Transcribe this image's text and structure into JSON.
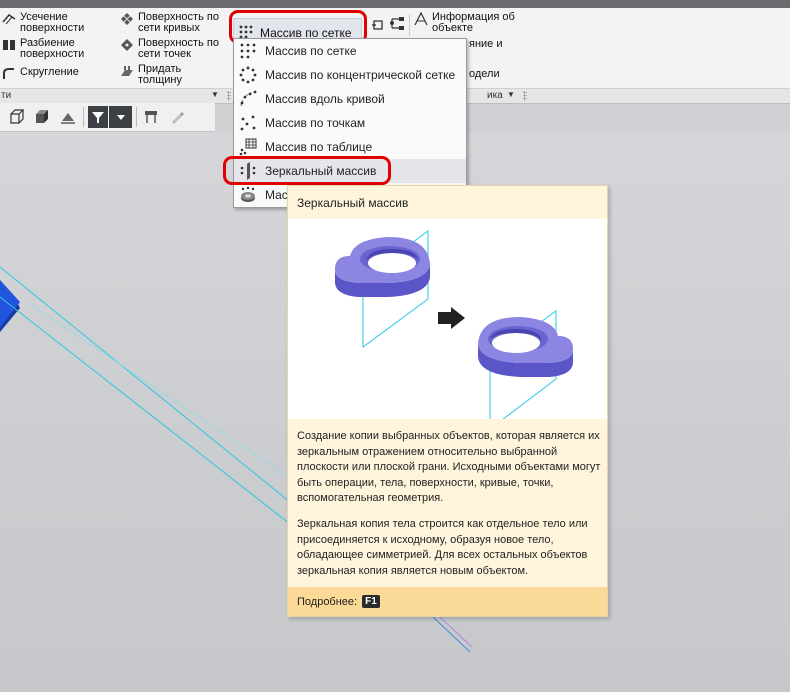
{
  "ribbon": {
    "col1": [
      {
        "icon": "trim-surface-icon",
        "label": "Усечение поверхности"
      },
      {
        "icon": "split-surface-icon",
        "label": "Разбиение поверхности"
      },
      {
        "icon": "fillet-icon",
        "label": "Скругление"
      }
    ],
    "col2": [
      {
        "icon": "curve-mesh-surface-icon",
        "label": "Поверхность по сети кривых"
      },
      {
        "icon": "point-mesh-surface-icon",
        "label": "Поверхность по сети точек"
      },
      {
        "icon": "thicken-icon",
        "label": "Придать толщину"
      }
    ],
    "array_button_label": "Массив по сетке",
    "info_label": "Информация об объекте",
    "partial_right_1": "яние и",
    "partial_right_2": "одели",
    "group_left": "ти",
    "group_right": "ика"
  },
  "dropdown": {
    "items": [
      {
        "icon": "grid-array-icon",
        "label": "Массив по сетке"
      },
      {
        "icon": "concentric-array-icon",
        "label": "Массив по концентрической сетке"
      },
      {
        "icon": "curve-array-icon",
        "label": "Массив вдоль кривой"
      },
      {
        "icon": "points-array-icon",
        "label": "Массив по точкам"
      },
      {
        "icon": "table-array-icon",
        "label": "Массив по таблице"
      },
      {
        "icon": "mirror-array-icon",
        "label": "Зеркальный массив"
      },
      {
        "icon": "component-array-icon",
        "label": "Масс"
      }
    ],
    "highlighted_index": 5
  },
  "tooltip": {
    "title": "Зеркальный массив",
    "paragraph1": "Создание копии выбранных объектов, которая является их зеркальным отражением относительно выбранной плоскости или плоской грани. Исходными объектами могут быть операции, тела, поверхности, кривые, точки, вспомогательная геометрия.",
    "paragraph2": "Зеркальная копия тела строится как отдельное тело или присоединяется к исходному, образуя новое тело, обладающее симметрией. Для всех остальных объектов зеркальная копия является новым объектом.",
    "footer_label": "Подробнее:",
    "footer_key": "F1"
  },
  "colors": {
    "highlight_ring": "#e00000",
    "tooltip_bg": "#fff5dd",
    "tooltip_footer": "#fbd996",
    "model_purple": "#8c86e2",
    "plane_cyan": "#29c8e0"
  }
}
